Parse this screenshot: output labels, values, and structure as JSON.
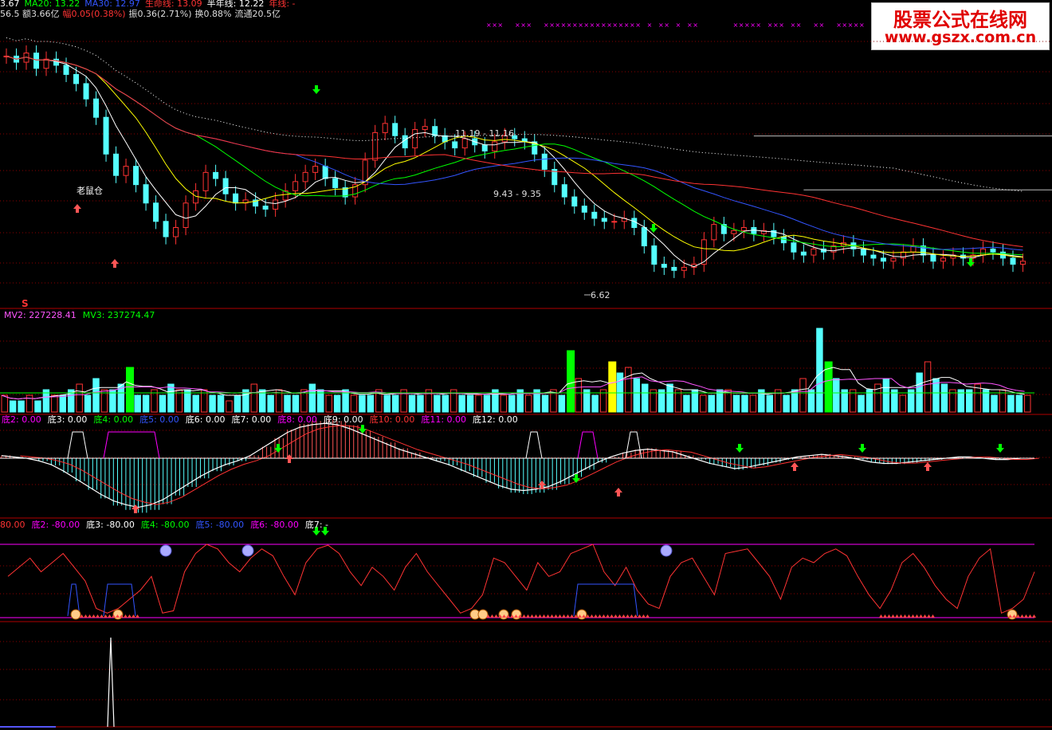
{
  "colors": {
    "background": "#000000",
    "up": "#ff3333",
    "down": "#55ffff",
    "ma5": "#ffffff",
    "ma10": "#ffff00",
    "ma20": "#00ff00",
    "ma30": "#3355ff",
    "life": "#ff3333",
    "halfyear": "#ffffff",
    "grid": "#8b0000",
    "magenta": "#ff00ff"
  },
  "header": {
    "row1": [
      {
        "text": "3.67",
        "color": "#ffffff"
      },
      {
        "text": "MA20: 13.22",
        "color": "#00ff00"
      },
      {
        "text": "MA30: 12.97",
        "color": "#3355ff"
      },
      {
        "text": "生命线: 13.09",
        "color": "#ff3333"
      },
      {
        "text": "半年线: 12.22",
        "color": "#ffffff"
      },
      {
        "text": "年线: -",
        "color": "#ff3333"
      }
    ],
    "row2": [
      {
        "text": "56.5 额3.66亿",
        "color": "#dddddd"
      },
      {
        "text": "幅0.05(0.38%)",
        "color": "#ff3333"
      },
      {
        "text": "振0.36(2.71%)",
        "color": "#dddddd"
      },
      {
        "text": "换0.88%",
        "color": "#dddddd"
      },
      {
        "text": "流通20.5亿",
        "color": "#dddddd"
      }
    ]
  },
  "watermark": {
    "line1": "股票公式在线网",
    "line2": "www.gszx.com.cn"
  },
  "price_annotations": {
    "old_mouse": "老鼠仓",
    "range1": "11.19 - 11.16",
    "range2": "9.43 - 9.35",
    "low_label": "6.62",
    "s_mark": "S"
  },
  "volume_header": [
    {
      "text": "MV2: 227228.41",
      "color": "#ff55ff"
    },
    {
      "text": "MV3: 237274.47",
      "color": "#00ff00"
    }
  ],
  "panel3_header": [
    {
      "text": "底2: 0.00",
      "color": "#ff00ff"
    },
    {
      "text": "底3: 0.00",
      "color": "#ffffff"
    },
    {
      "text": "底4: 0.00",
      "color": "#00ff00"
    },
    {
      "text": "底5: 0.00",
      "color": "#3355ff"
    },
    {
      "text": "底6: 0.00",
      "color": "#ffffff"
    },
    {
      "text": "底7: 0.00",
      "color": "#ffffff"
    },
    {
      "text": "底8: 0.00",
      "color": "#ff00ff"
    },
    {
      "text": "底9: 0.00",
      "color": "#ffffff"
    },
    {
      "text": "底10: 0.00",
      "color": "#ff3333"
    },
    {
      "text": "底11: 0.00",
      "color": "#ff00ff"
    },
    {
      "text": "底12: 0.00",
      "color": "#ffffff"
    }
  ],
  "panel4_header": [
    {
      "text": "80.00",
      "color": "#ff3333"
    },
    {
      "text": "底2: -80.00",
      "color": "#ff00ff"
    },
    {
      "text": "底3: -80.00",
      "color": "#ffffff"
    },
    {
      "text": "底4: -80.00",
      "color": "#00ff00"
    },
    {
      "text": "底5: -80.00",
      "color": "#3355ff"
    },
    {
      "text": "底6: -80.00",
      "color": "#ff00ff"
    },
    {
      "text": "底7: -",
      "color": "#ffffff"
    }
  ],
  "chart_data": {
    "type": "line",
    "title": "",
    "panels": [
      "price candlestick with MA5/MA10/MA20/MA30/生命线/半年线",
      "volume with MV2/MV3",
      "底 oscillator histogram",
      "底 signal oscillator",
      "spike indicator"
    ],
    "price": {
      "ylim": [
        6.0,
        14.2
      ],
      "marked_levels": [
        {
          "label": "11.19 - 11.16",
          "value": 11.19
        },
        {
          "label": "9.43 - 9.35",
          "value": 9.43
        }
      ],
      "low": 6.62,
      "close_series": [
        13.8,
        13.6,
        13.9,
        13.4,
        13.7,
        13.5,
        13.2,
        12.9,
        12.4,
        11.8,
        10.6,
        9.9,
        10.2,
        9.6,
        9.0,
        8.4,
        7.9,
        8.2,
        9.0,
        9.4,
        10.0,
        9.8,
        9.3,
        9.0,
        9.1,
        8.9,
        8.8,
        9.1,
        9.4,
        9.7,
        10.0,
        10.2,
        9.8,
        9.5,
        9.2,
        9.6,
        10.4,
        11.3,
        11.6,
        11.2,
        10.8,
        11.4,
        11.5,
        11.2,
        11.0,
        10.8,
        11.1,
        10.9,
        10.7,
        11.0,
        11.2,
        11.1,
        11.0,
        10.6,
        10.1,
        9.6,
        9.2,
        8.9,
        8.7,
        8.5,
        8.4,
        8.4,
        8.5,
        8.2,
        7.6,
        7.0,
        6.9,
        6.8,
        6.9,
        7.0,
        7.8,
        8.3,
        8.0,
        8.1,
        8.2,
        8.0,
        8.1,
        7.9,
        7.7,
        7.4,
        7.3,
        7.5,
        7.4,
        7.6,
        7.7,
        7.5,
        7.3,
        7.2,
        7.1,
        7.2,
        7.4,
        7.6,
        7.3,
        7.1,
        7.2,
        7.3,
        7.2,
        7.3,
        7.5,
        7.4,
        7.2,
        7.0,
        7.1
      ]
    },
    "volume": {
      "series": [
        {
          "name": "MV2",
          "last": 227228.41
        },
        {
          "name": "MV3",
          "last": 237274.47
        }
      ],
      "bars": [
        3,
        2,
        2,
        3,
        2,
        4,
        3,
        3,
        4,
        5,
        3,
        6,
        4,
        4,
        5,
        8,
        3,
        3,
        4,
        3,
        5,
        4,
        4,
        3,
        4,
        3,
        3,
        2,
        3,
        4,
        5,
        4,
        3,
        4,
        3,
        3,
        4,
        5,
        4,
        3,
        3,
        4,
        3,
        3,
        3,
        4,
        3,
        3,
        4,
        3,
        3,
        4,
        3,
        3,
        4,
        3,
        3,
        3,
        3,
        4,
        3,
        3,
        4,
        3,
        4,
        3,
        4,
        3,
        11,
        6,
        4,
        3,
        4,
        9,
        7,
        8,
        6,
        5,
        4,
        4,
        5,
        4,
        3,
        4,
        3,
        3,
        4,
        4,
        3,
        3,
        3,
        4,
        3,
        4,
        3,
        4,
        6,
        4,
        15,
        9,
        6,
        4,
        4,
        3,
        4,
        5,
        6,
        4,
        3,
        4,
        7,
        9,
        6,
        5,
        4,
        4,
        4,
        5,
        4,
        3,
        4,
        3,
        3,
        3
      ],
      "highlight": [
        {
          "index": 15,
          "color": "#00ff00"
        },
        {
          "index": 68,
          "color": "#00ff00"
        },
        {
          "index": 73,
          "color": "#ffff00"
        },
        {
          "index": 99,
          "color": "#00ff00"
        }
      ]
    },
    "oscillator": {
      "values": [
        0.2,
        0.1,
        0,
        -0.2,
        -0.5,
        -1.0,
        -1.6,
        -2.2,
        -2.8,
        -3.3,
        -3.6,
        -3.8,
        -3.6,
        -3.2,
        -2.6,
        -2.0,
        -1.4,
        -0.9,
        -0.5,
        -0.2,
        0.2,
        0.8,
        1.4,
        2.0,
        2.4,
        2.6,
        2.7,
        2.6,
        2.3,
        1.9,
        1.5,
        1.1,
        0.7,
        0.4,
        0.1,
        -0.2,
        -0.5,
        -0.9,
        -1.3,
        -1.7,
        -2.1,
        -2.4,
        -2.5,
        -2.4,
        -2.2,
        -1.8,
        -1.3,
        -0.8,
        -0.3,
        0.1,
        0.4,
        0.6,
        0.7,
        0.6,
        0.5,
        0.2,
        -0.1,
        -0.4,
        -0.6,
        -0.8,
        -0.7,
        -0.5,
        -0.3,
        -0.1,
        0.1,
        0.2,
        0.3,
        0.2,
        0.1,
        -0.1,
        -0.3,
        -0.4,
        -0.4,
        -0.3,
        -0.2,
        -0.1,
        0.0,
        0.1,
        0.1,
        0.0,
        -0.1,
        -0.1,
        0.0
      ]
    },
    "signal_line": {
      "ylim": [
        -80,
        80
      ],
      "values": [
        10,
        30,
        50,
        20,
        40,
        60,
        30,
        0,
        -60,
        -70,
        -60,
        -40,
        -20,
        10,
        -70,
        -65,
        20,
        60,
        80,
        70,
        40,
        20,
        50,
        70,
        55,
        10,
        -30,
        40,
        70,
        78,
        60,
        20,
        -10,
        30,
        10,
        -20,
        30,
        60,
        20,
        -10,
        -40,
        -70,
        -60,
        -30,
        50,
        40,
        10,
        -20,
        40,
        10,
        20,
        60,
        70,
        80,
        20,
        -10,
        30,
        -20,
        -50,
        -60,
        10,
        40,
        50,
        10,
        -30,
        60,
        65,
        70,
        40,
        10,
        -40,
        30,
        50,
        40,
        60,
        70,
        55,
        10,
        -30,
        -60,
        -20,
        40,
        60,
        30,
        -10,
        -40,
        -60,
        10,
        50,
        70,
        -70,
        -60,
        -40,
        20
      ]
    },
    "spike": {
      "index": 14,
      "value": 1
    }
  }
}
